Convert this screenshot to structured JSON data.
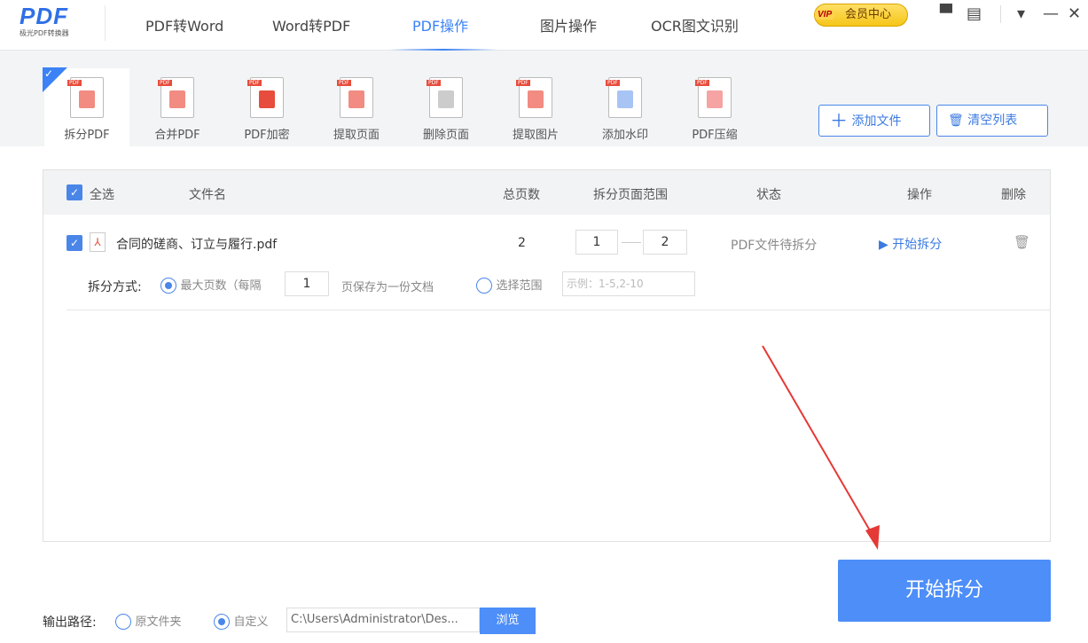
{
  "app": {
    "logo_text": "PDF",
    "logo_subtitle": "极光PDF转换器"
  },
  "nav": [
    "PDF转Word",
    "Word转PDF",
    "PDF操作",
    "图片操作",
    "OCR图文识别"
  ],
  "vip": {
    "badge": "VIP",
    "label": "会员中心"
  },
  "window_controls": {
    "skin": "▀",
    "feedback": "▤",
    "menu": "▾",
    "minimize": "—",
    "close": "✕"
  },
  "tools": [
    {
      "label": "拆分PDF",
      "color": "#f28b82"
    },
    {
      "label": "合并PDF",
      "color": "#f28b82"
    },
    {
      "label": "PDF加密",
      "color": "#e74c3c"
    },
    {
      "label": "提取页面",
      "color": "#f28b82"
    },
    {
      "label": "删除页面",
      "color": "#cccccc"
    },
    {
      "label": "提取图片",
      "color": "#f28b82"
    },
    {
      "label": "添加水印",
      "color": "#a8c4f5"
    },
    {
      "label": "PDF压缩",
      "color": "#f5a3a3"
    }
  ],
  "actions": {
    "add_file": "添加文件",
    "clear_list": "清空列表"
  },
  "table": {
    "headers": {
      "select_all": "全选",
      "filename": "文件名",
      "pages": "总页数",
      "range": "拆分页面范围",
      "status": "状态",
      "action": "操作",
      "delete": "删除"
    },
    "rows": [
      {
        "filename": "合同的磋商、订立与履行.pdf",
        "pages": "2",
        "range_from": "1",
        "range_to": "2",
        "status": "PDF文件待拆分",
        "action": "开始拆分"
      }
    ],
    "split_mode": {
      "label": "拆分方式:",
      "opt_max": "最大页数（每隔",
      "every": "1",
      "suffix": "页保存为一份文档",
      "opt_range": "选择范围",
      "range_placeholder": "示例：1-5,2-10"
    }
  },
  "output": {
    "label": "输出路径:",
    "opt_original": "原文件夹",
    "opt_custom": "自定义",
    "path": "C:\\Users\\Administrator\\Des...",
    "browse": "浏览"
  },
  "start_button": "开始拆分"
}
